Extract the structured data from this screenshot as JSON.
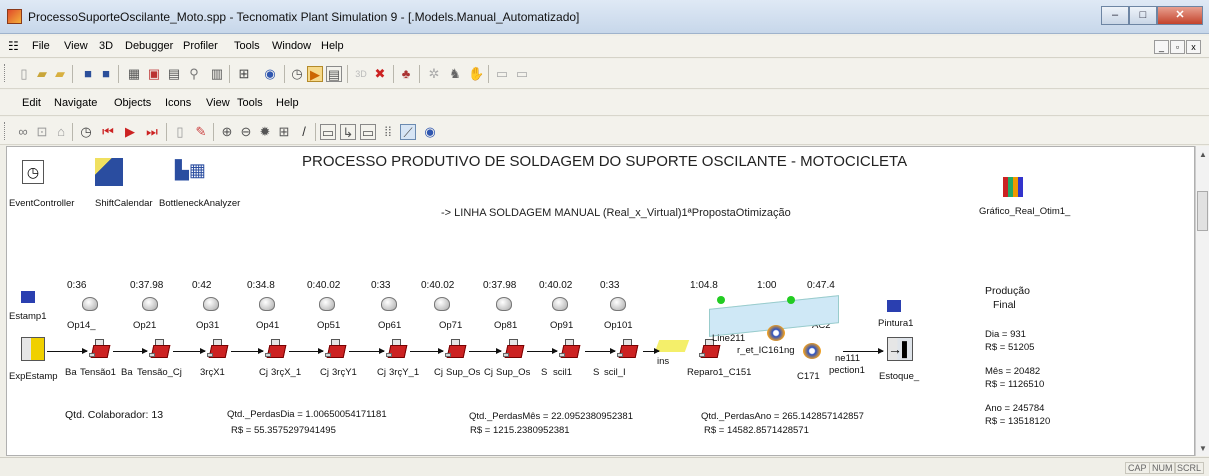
{
  "window": {
    "title": "ProcessoSuporteOscilante_Moto.spp - Tecnomatix Plant Simulation 9 - [.Models.Manual_Automatizado]",
    "min": "–",
    "max": "□",
    "close": "✕"
  },
  "menu": [
    "File",
    "View",
    "3D",
    "Debugger",
    "Profiler",
    "Tools",
    "Window",
    "Help"
  ],
  "mdi": [
    "_",
    "▫",
    "x"
  ],
  "secondary_menu": [
    "Edit",
    "Navigate",
    "Objects",
    "Icons",
    "View",
    "Tools",
    "Help"
  ],
  "toolbar1_icons": [
    "new-icon",
    "open-icon",
    "folder-icon",
    "save-icon",
    "save-all-icon",
    "frame-icon",
    "frame-30-icon",
    "frame-list-icon",
    "wand-icon",
    "library-icon",
    "network-icon",
    "help-icon",
    "clock-icon",
    "toggle-icon",
    "window-icon",
    "3d-icon",
    "cancel-icon",
    "puzzle-icon",
    "tree-icon",
    "class-icon",
    "tools-icon",
    "panel-icon",
    "panel2-icon"
  ],
  "toolbar2_icons": [
    "binoculars-icon",
    "zoom-box-icon",
    "home-icon",
    "clock-icon",
    "reset-icon",
    "play-icon",
    "step-icon",
    "trash-icon",
    "brush-icon",
    "zoom-in-icon",
    "zoom-out-icon",
    "sun-icon",
    "grid-icon",
    "pencil-icon",
    "connector-icon",
    "line-icon",
    "comment-icon",
    "dots-icon",
    "route-icon",
    "help-icon"
  ],
  "canvas": {
    "title": "PROCESSO PRODUTIVO DE SOLDAGEM DO SUPORTE OSCILANTE - MOTOCICLETA",
    "subtitle": "-> LINHA SOLDAGEM MANUAL (Real_x_Virtual)1ªPropostaOtimização",
    "top_objects": [
      "EventController",
      "ShiftCalendar",
      "BottleneckAnalyzer"
    ],
    "chart_object": "Gráfico_Real_Otim1_",
    "times": [
      "0:36",
      "0:37.98",
      "0:42",
      "0:34.8",
      "0:40.02",
      "0:33",
      "0:40.02",
      "0:37.98",
      "0:40.02",
      "0:33",
      "1:04.8",
      "1:00",
      "0:47.4"
    ],
    "upper_labels": [
      "Estamp1",
      "Op14_",
      "Op21",
      "Op31",
      "Op41",
      "Op51",
      "Op61",
      "Op71",
      "Op81",
      "Op91",
      "Op101",
      "AC2",
      "Pintura1"
    ],
    "lower_labels": [
      "ExpEstamp",
      "Ba",
      "Tensão1",
      "Ba",
      "Tensão_Cj",
      "3rçX1",
      "Cj",
      "3rçX_1",
      "Cj",
      "3rçY1",
      "Cj",
      "3rçY_1",
      "Cj",
      "Sup_Os",
      "Cj",
      "Sup_Os",
      "S",
      "scil1",
      "S",
      "scil_I",
      "Reparo1_C151",
      "C171",
      "Estoque_"
    ],
    "misc_labels": [
      "ins",
      "Line211",
      "r_et_IC161ng",
      "ne111",
      "pection1"
    ],
    "production": {
      "title1": "Produção",
      "title2": "Final",
      "dia": "Dia = 931",
      "dia_rs": "R$ = 51205",
      "mes": "Mês = 20482",
      "mes_rs": "R$ = 1126510",
      "ano": "Ano = 245784",
      "ano_rs": "R$ = 13518120"
    },
    "qtd_colaborador": "Qtd. Colaborador: 13",
    "perdas_dia": "Qtd._PerdasDia = 1.00650054171181",
    "perdas_dia_rs": "R$ = 55.3575297941495",
    "perdas_mes": "Qtd._PerdasMês = 22.0952380952381",
    "perdas_mes_rs": "R$ = 1215.2380952381",
    "perdas_ano": "Qtd._PerdasAno = 265.142857142857",
    "perdas_ano_rs": "R$ = 14582.8571428571"
  },
  "status": [
    "CAP",
    "NUM",
    "SCRL"
  ],
  "colors": {
    "station_red": "#c22222",
    "titlebar": "#c7d7ea",
    "conveyor": "#cfe8f6"
  }
}
